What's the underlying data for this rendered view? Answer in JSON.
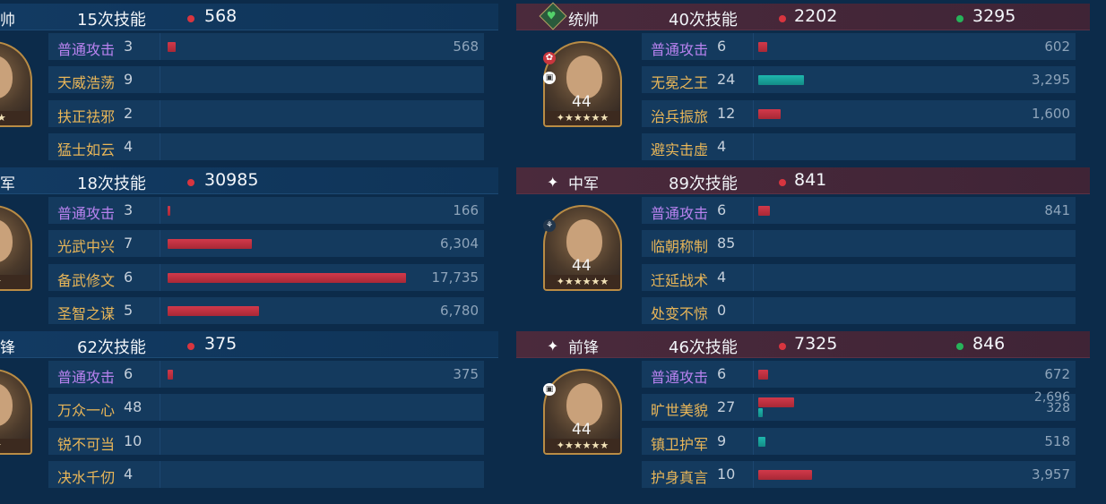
{
  "left": {
    "sections": [
      {
        "role": "帅",
        "skills": "15次技能",
        "total": "568",
        "stars": "★★★",
        "rows": [
          {
            "name": "普通攻击",
            "count": "3",
            "value": "568",
            "bar": 0.034,
            "basic": true
          },
          {
            "name": "天威浩荡",
            "count": "9",
            "value": ""
          },
          {
            "name": "扶正祛邪",
            "count": "2",
            "value": ""
          },
          {
            "name": "猛士如云",
            "count": "4",
            "value": ""
          }
        ]
      },
      {
        "role": "军",
        "skills": "18次技能",
        "total": "30985",
        "stars": "★★",
        "rows": [
          {
            "name": "普通攻击",
            "count": "3",
            "value": "166",
            "bar": 0.01,
            "basic": true
          },
          {
            "name": "光武中兴",
            "count": "7",
            "value": "6,304",
            "bar": 0.355
          },
          {
            "name": "备武修文",
            "count": "6",
            "value": "17,735",
            "bar": 1.0
          },
          {
            "name": "圣智之谋",
            "count": "5",
            "value": "6,780",
            "bar": 0.382
          }
        ]
      },
      {
        "role": "锋",
        "skills": "62次技能",
        "total": "375",
        "stars": "★★",
        "rows": [
          {
            "name": "普通攻击",
            "count": "6",
            "value": "375",
            "bar": 0.021,
            "basic": true
          },
          {
            "name": "万众一心",
            "count": "48",
            "value": ""
          },
          {
            "name": "锐不可当",
            "count": "10",
            "value": ""
          },
          {
            "name": "决水千仞",
            "count": "4",
            "value": ""
          }
        ]
      }
    ]
  },
  "right": {
    "sections": [
      {
        "role": "统帅",
        "skills": "40次技能",
        "total_red": "2202",
        "total_green": "3295",
        "level": "44",
        "stars": "✦★★★★★",
        "rows": [
          {
            "name": "普通攻击",
            "count": "6",
            "value": "602",
            "bar": 0.036,
            "basic": true
          },
          {
            "name": "无冕之王",
            "count": "24",
            "value": "3,295",
            "bar": 0.19,
            "heal": true
          },
          {
            "name": "治兵振旅",
            "count": "12",
            "value": "1,600",
            "bar": 0.095
          },
          {
            "name": "避实击虚",
            "count": "4",
            "value": ""
          }
        ]
      },
      {
        "role": "中军",
        "skills": "89次技能",
        "total_red": "841",
        "level": "44",
        "stars": "✦★★★★★",
        "rows": [
          {
            "name": "普通攻击",
            "count": "6",
            "value": "841",
            "bar": 0.05,
            "basic": true
          },
          {
            "name": "临朝称制",
            "count": "85",
            "value": ""
          },
          {
            "name": "迁延战术",
            "count": "4",
            "value": ""
          },
          {
            "name": "处变不惊",
            "count": "0",
            "value": ""
          }
        ]
      },
      {
        "role": "前锋",
        "skills": "46次技能",
        "total_red": "7325",
        "total_green": "846",
        "level": "44",
        "stars": "✦★★★★★",
        "rows": [
          {
            "name": "普通攻击",
            "count": "6",
            "value": "672",
            "bar": 0.04,
            "basic": true
          },
          {
            "name": "旷世美貌",
            "count": "27",
            "value": "2,696",
            "value2": "328",
            "bar": 0.15,
            "bar2": 0.02,
            "basic": false
          },
          {
            "name": "镇卫护军",
            "count": "9",
            "value": "518",
            "bar": 0.03,
            "heal": true
          },
          {
            "name": "护身真言",
            "count": "10",
            "value": "3,957",
            "bar": 0.225
          }
        ]
      }
    ]
  },
  "colors": {
    "red_dot": "#d8353f",
    "green_dot": "#27b35a"
  }
}
